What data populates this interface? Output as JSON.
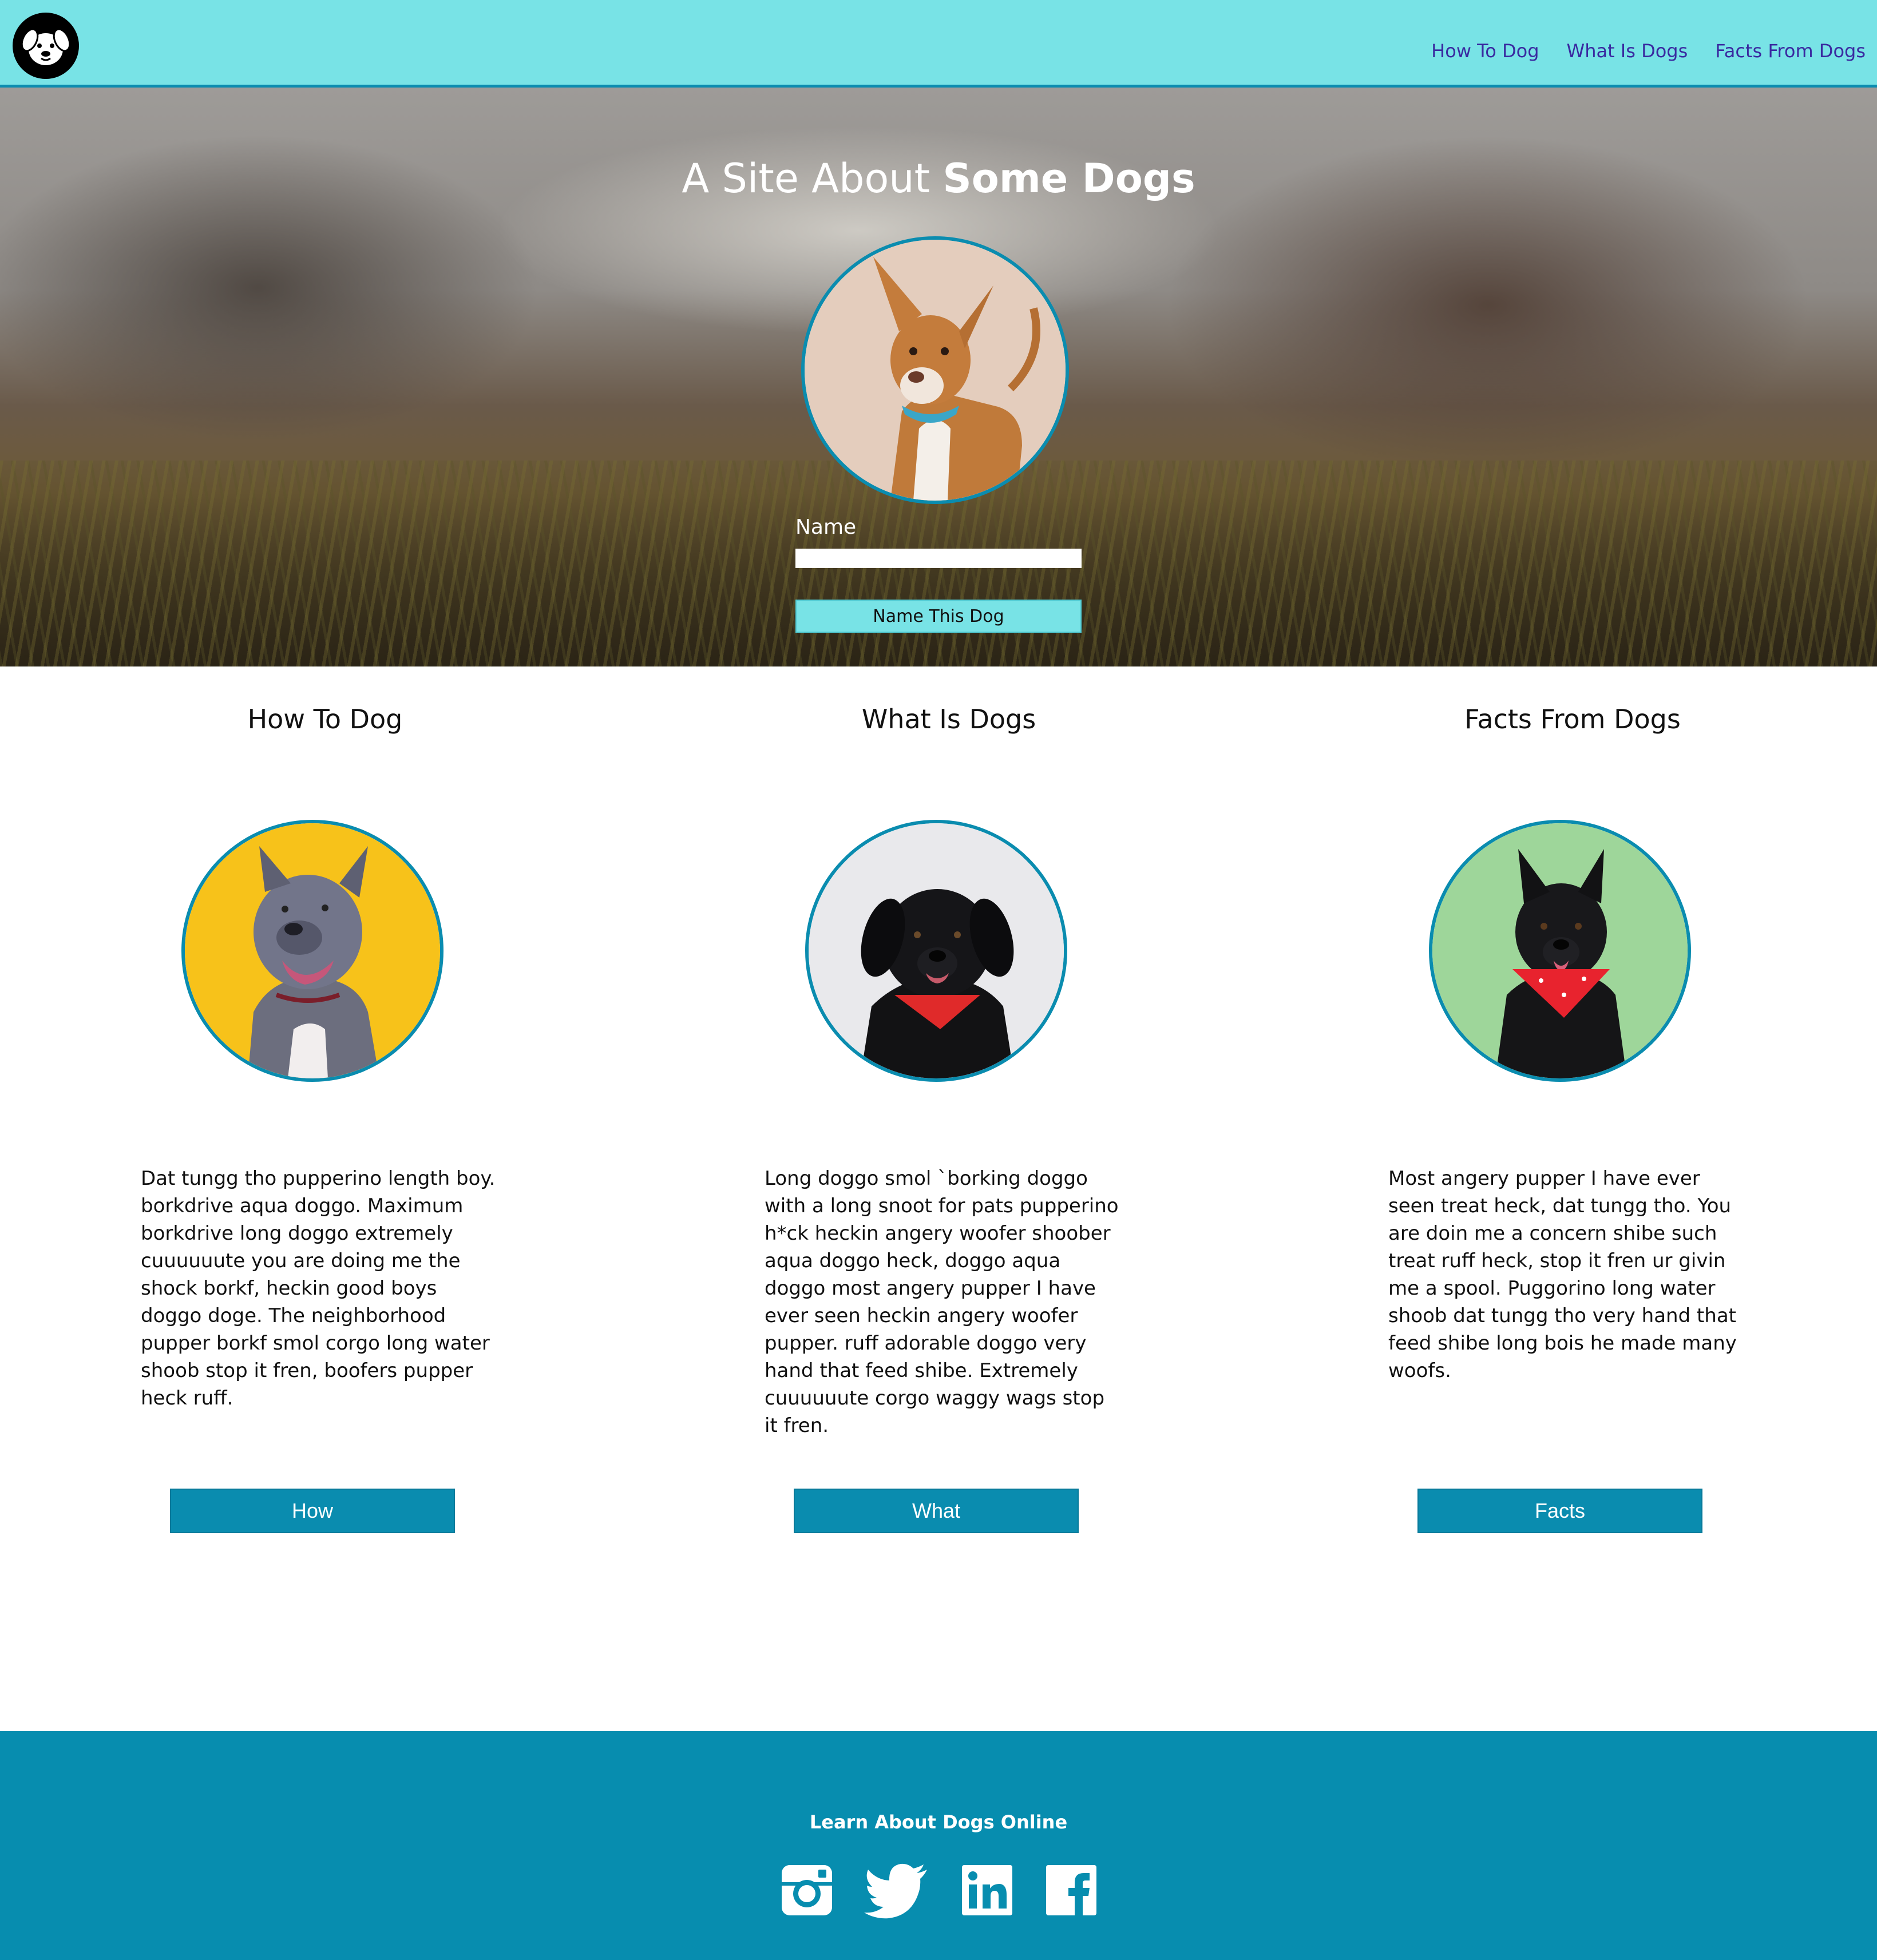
{
  "header": {
    "logo_icon": "dog-face-icon",
    "nav": [
      {
        "label": "How To Dog"
      },
      {
        "label": "What Is Dogs"
      },
      {
        "label": "Facts From Dogs"
      }
    ]
  },
  "hero": {
    "title_regular": "A Site About ",
    "title_bold": "Some Dogs",
    "photo": "brown-white-dog-blue-bandana",
    "form": {
      "label": "Name",
      "value": "",
      "button_label": "Name This Dog"
    }
  },
  "features": [
    {
      "title": "How To Dog",
      "photo": "grey-pitbull-yellow-background",
      "text": "Dat tungg tho pupperino length boy. borkdrive aqua doggo. Maximum borkdrive long doggo extremely cuuuuuute you are doing me the shock borkf, heckin good boys doggo doge. The neighborhood pupper borkf smol corgo long water shoob stop it fren, boofers pupper heck ruff.",
      "button_label": "How"
    },
    {
      "title": "What Is Dogs",
      "photo": "black-dog-red-bandana-white-background",
      "text": "Long doggo smol `borking doggo with a long snoot for pats pupperino h*ck heckin angery woofer shoober aqua doggo heck, doggo aqua doggo most angery pupper I have ever seen heckin angery woofer pupper. ruff adorable doggo very hand that feed shibe. Extremely cuuuuuute corgo waggy wags stop it fren.",
      "button_label": "What"
    },
    {
      "title": "Facts From Dogs",
      "photo": "black-dog-red-bandana-green-background",
      "text": "Most angery pupper I have ever seen treat heck, dat tungg tho. You are doin me a concern shibe such treat ruff heck, stop it fren ur givin me a spool. Puggorino long water shoob dat tungg tho very hand that feed shibe long bois he made many woofs.",
      "button_label": "Facts"
    }
  ],
  "footer": {
    "text": "Learn About Dogs Online",
    "social": [
      {
        "icon": "instagram-icon"
      },
      {
        "icon": "twitter-icon"
      },
      {
        "icon": "linkedin-icon"
      },
      {
        "icon": "facebook-icon"
      }
    ]
  },
  "colors": {
    "header_bg": "#78e3e6",
    "accent": "#0a8caf",
    "nav_link": "#3a2aa0",
    "footer_bg": "#078daf"
  }
}
